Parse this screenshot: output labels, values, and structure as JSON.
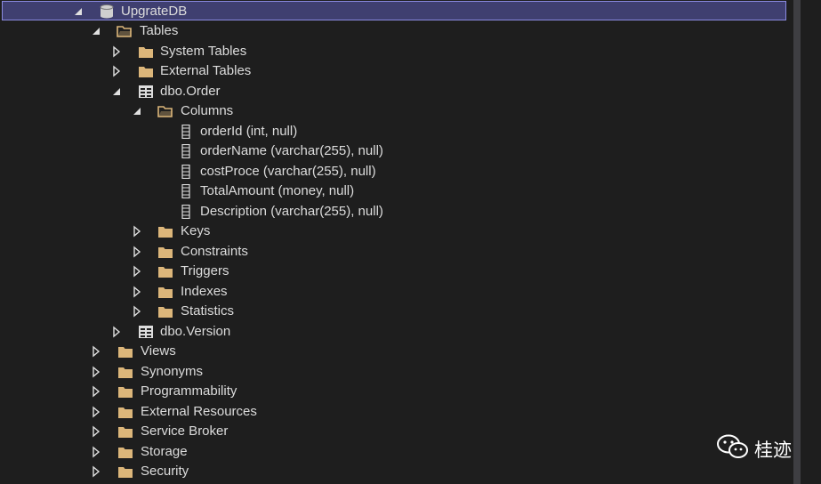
{
  "tree": {
    "database": "UpgrateDB",
    "tables_folder": "Tables",
    "system_tables": "System Tables",
    "external_tables": "External Tables",
    "table_order": "dbo.Order",
    "columns_folder": "Columns",
    "columns": [
      "orderId (int, null)",
      "orderName (varchar(255), null)",
      "costProce (varchar(255), null)",
      "TotalAmount (money, null)",
      "Description (varchar(255), null)"
    ],
    "order_subfolders": [
      "Keys",
      "Constraints",
      "Triggers",
      "Indexes",
      "Statistics"
    ],
    "table_version": "dbo.Version",
    "db_folders": [
      "Views",
      "Synonyms",
      "Programmability",
      "External Resources",
      "Service Broker",
      "Storage",
      "Security"
    ]
  },
  "watermark": {
    "text": "桂迹",
    "icon": "wechat-icon"
  },
  "colors": {
    "background": "#1e1e1e",
    "selection": "#3f3f70",
    "folder": "#dcb67a",
    "text": "#dcdcdc"
  }
}
